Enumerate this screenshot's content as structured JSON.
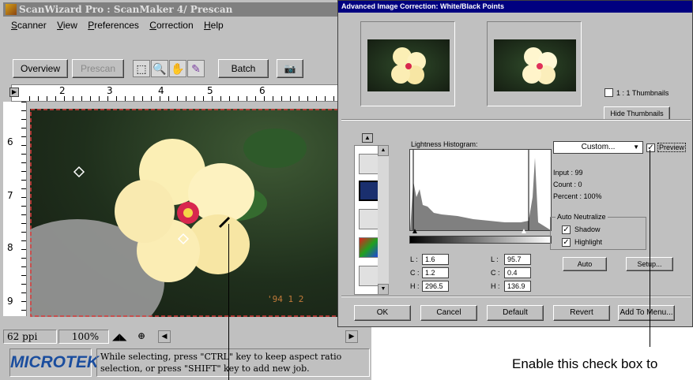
{
  "main": {
    "title": "ScanWizard Pro : ScanMaker 4/ Prescan",
    "menu": [
      {
        "first": "S",
        "rest": "canner"
      },
      {
        "first": "V",
        "rest": "iew"
      },
      {
        "first": "P",
        "rest": "references"
      },
      {
        "first": "C",
        "rest": "orrection"
      },
      {
        "first": "H",
        "rest": "elp"
      }
    ],
    "toolbar": {
      "overview": "Overview",
      "prescan": "Prescan",
      "batch": "Batch"
    },
    "ruler_h": [
      "2",
      "3",
      "4",
      "5",
      "6"
    ],
    "ruler_v": [
      "6",
      "7",
      "8",
      "9"
    ],
    "photo_date": "'94 1 2",
    "status": {
      "resolution": "62 ppi",
      "zoom": "100%"
    },
    "logo": "MICROTEK",
    "hint": "While selecting, press \"CTRL\" key to keep aspect ratio selection, or press \"SHIFT\" key to add new job."
  },
  "dialog": {
    "title": "Advanced Image Correction: White/Black Points",
    "thumbs_1to1": "1 : 1 Thumbnails",
    "hide_thumbs": "Hide Thumbnails",
    "histogram_label": "Lightness Histogram:",
    "preset": "Custom...",
    "preview": "Preview",
    "info": {
      "input": "Input :   99",
      "count": "Count :   0",
      "percent": "Percent : 100%"
    },
    "auto_neutralize": "Auto Neutralize",
    "shadow": "Shadow",
    "highlight": "Highlight",
    "auto": "Auto",
    "setup": "Setup...",
    "left_vals": {
      "L": "1.6",
      "C": "1.2",
      "H": "296.5"
    },
    "right_vals": {
      "L": "95.7",
      "C": "0.4",
      "H": "136.9"
    },
    "buttons": {
      "ok": "OK",
      "cancel": "Cancel",
      "default": "Default",
      "revert": "Revert",
      "add_to_menu": "Add To Menu..."
    }
  },
  "caption": "Enable this check box to"
}
